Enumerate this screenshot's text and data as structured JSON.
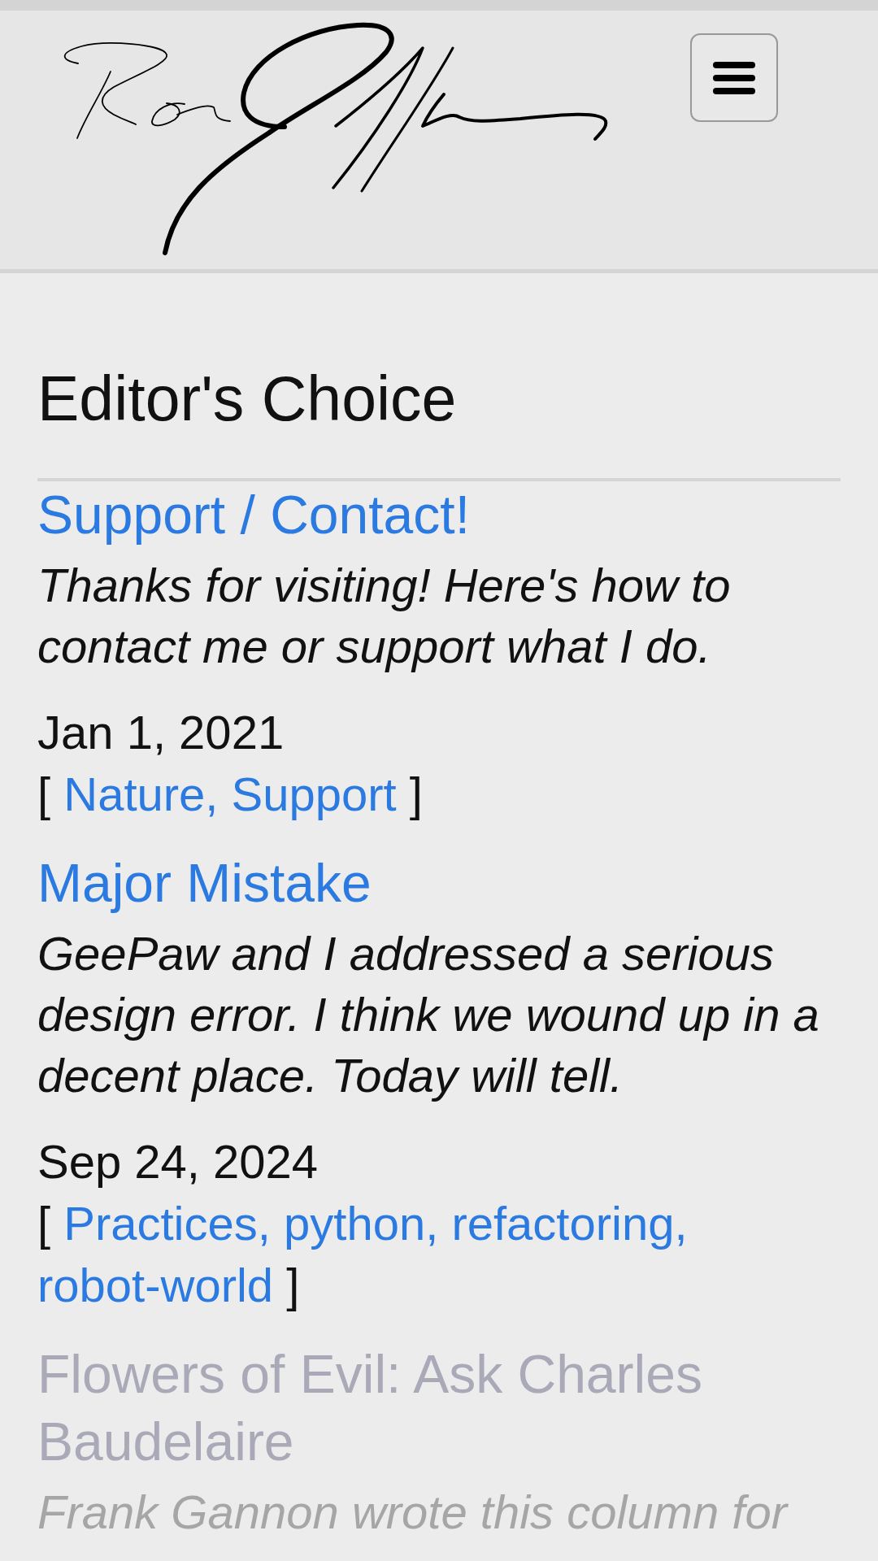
{
  "section": {
    "title": "Editor's Choice"
  },
  "posts": [
    {
      "title": "Support / Contact!",
      "description": "Thanks for visiting! Here's how to contact me or support what I do.",
      "date": "Jan 1, 2021",
      "tags": {
        "open": "[",
        "links": [
          "Nature,",
          "Support"
        ],
        "close": "]"
      },
      "faded": false
    },
    {
      "title": "Major Mistake",
      "description": "GeePaw and I addressed a serious design error. I think we wound up in a decent place. Today will tell.",
      "date": "Sep 24, 2024",
      "tags": {
        "open": "[",
        "links": [
          "Practices,",
          "python,",
          "refactoring,",
          "robot-world"
        ],
        "close": "]"
      },
      "faded": false
    },
    {
      "title": "Flowers of Evil: Ask Charles Baudelaire",
      "description": "Frank Gannon wrote this column for",
      "faded": true
    }
  ]
}
